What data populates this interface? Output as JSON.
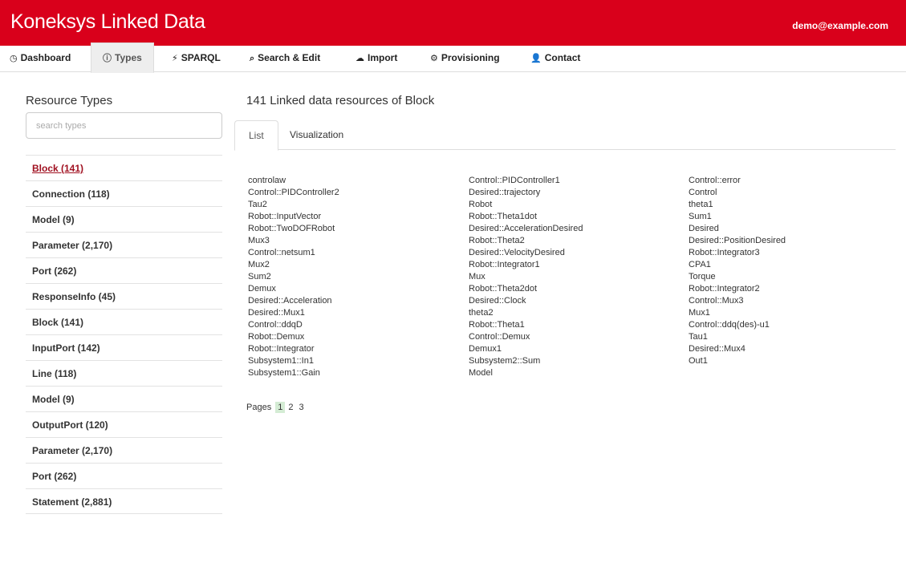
{
  "header": {
    "brand": "Koneksys Linked Data",
    "user": "demo@example.com",
    "colors": {
      "brand_red": "#d9001b",
      "active_link": "#a01020",
      "current_page_bg": "#d4ecd4"
    }
  },
  "nav": {
    "items": [
      {
        "label": "Dashboard",
        "icon": "clock-icon",
        "glyph": "◷"
      },
      {
        "label": "Types",
        "icon": "info-icon",
        "glyph": "ⓘ"
      },
      {
        "label": "SPARQL",
        "icon": "lightning-icon",
        "glyph": "⚡"
      },
      {
        "label": "Search & Edit",
        "icon": "search-icon",
        "glyph": "⌕"
      },
      {
        "label": "Import",
        "icon": "cloud-upload-icon",
        "glyph": "☁"
      },
      {
        "label": "Provisioning",
        "icon": "gear-icon",
        "glyph": "⚙"
      },
      {
        "label": "Contact",
        "icon": "user-icon",
        "glyph": "👤"
      }
    ],
    "active": "Types"
  },
  "sidebar": {
    "title": "Resource Types",
    "search_placeholder": "search types",
    "types": [
      "Block (141)",
      "Connection (118)",
      "Model (9)",
      "Parameter (2,170)",
      "Port (262)",
      "ResponseInfo (45)",
      "Block (141)",
      "InputPort (142)",
      "Line (118)",
      "Model (9)",
      "OutputPort (120)",
      "Parameter (2,170)",
      "Port (262)",
      "Statement (2,881)"
    ],
    "active_type": "Block (141)"
  },
  "main": {
    "title": "141 Linked data resources of Block",
    "tabs": [
      "List",
      "Visualization"
    ],
    "active_tab": "List",
    "columns": [
      [
        "controlaw",
        "Control::PIDController2",
        "Tau2",
        "Robot::InputVector",
        "Robot::TwoDOFRobot",
        "Mux3",
        "Control::netsum1",
        "Mux2",
        "Sum2",
        "Demux",
        "Desired::Acceleration",
        "Desired::Mux1",
        "Control::ddqD",
        "Robot::Demux",
        "Robot::Integrator",
        "Subsystem1::In1",
        "Subsystem1::Gain"
      ],
      [
        "Control::PIDController1",
        "Desired::trajectory",
        "Robot",
        "Robot::Theta1dot",
        "Desired::AccelerationDesired",
        "Robot::Theta2",
        "Desired::VelocityDesired",
        "Robot::Integrator1",
        "Mux",
        "Robot::Theta2dot",
        "Desired::Clock",
        "theta2",
        "Robot::Theta1",
        "Control::Demux",
        "Demux1",
        "Subsystem2::Sum",
        "Model"
      ],
      [
        "Control::error",
        "Control",
        "theta1",
        "Sum1",
        "Desired",
        "Desired::PositionDesired",
        "Robot::Integrator3",
        "CPA1",
        "Torque",
        "Robot::Integrator2",
        "Control::Mux3",
        "Mux1",
        "Control::ddq(des)-u1",
        "Tau1",
        "Desired::Mux4",
        "Out1"
      ]
    ],
    "pager": {
      "label": "Pages",
      "pages": [
        "1",
        "2",
        "3"
      ],
      "current": "1"
    }
  }
}
